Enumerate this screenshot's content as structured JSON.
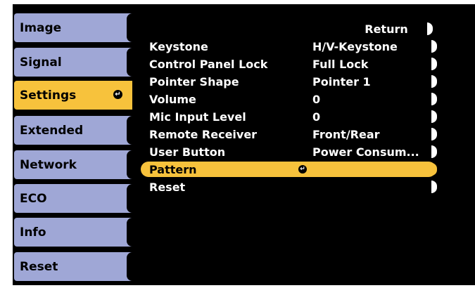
{
  "sidebar": {
    "items": [
      {
        "label": "Image"
      },
      {
        "label": "Signal"
      },
      {
        "label": "Settings",
        "active": true
      },
      {
        "label": "Extended"
      },
      {
        "label": "Network"
      },
      {
        "label": "ECO"
      },
      {
        "label": "Info"
      },
      {
        "label": "Reset"
      }
    ]
  },
  "panel": {
    "return_label": "Return",
    "rows": [
      {
        "label": "Keystone",
        "value": "H/V-Keystone"
      },
      {
        "label": "Control Panel Lock",
        "value": "Full Lock"
      },
      {
        "label": "Pointer Shape",
        "value": "Pointer 1"
      },
      {
        "label": "Volume",
        "value": "0"
      },
      {
        "label": "Mic Input Level",
        "value": "0"
      },
      {
        "label": "Remote Receiver",
        "value": "Front/Rear"
      },
      {
        "label": "User Button",
        "value": "Power Consum..."
      },
      {
        "label": "Pattern",
        "value": "",
        "active": true
      },
      {
        "label": "Reset",
        "value": ""
      }
    ]
  },
  "colors": {
    "background": "#000000",
    "tab_inactive": "#9fa7d6",
    "tab_active": "#f7c23c",
    "row_active": "#f7c23c"
  },
  "icons": {
    "enter": "enter-return-icon"
  }
}
